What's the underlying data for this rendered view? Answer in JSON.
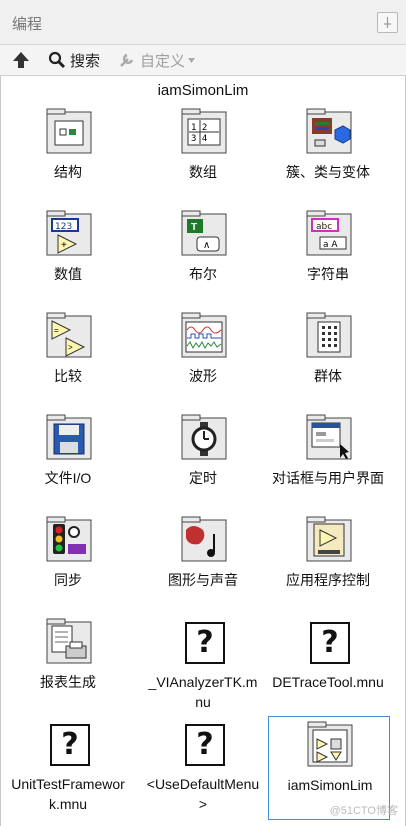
{
  "window": {
    "title": "编程"
  },
  "toolbar": {
    "up_label": "",
    "search_label": "搜索",
    "custom_label": "自定义"
  },
  "palette": {
    "title": "iamSimonLim"
  },
  "items": [
    {
      "label": "结构",
      "icon": "structures-icon"
    },
    {
      "label": "数组",
      "icon": "array-icon"
    },
    {
      "label": "簇、类与变体",
      "icon": "cluster-class-variant-icon"
    },
    {
      "label": "数值",
      "icon": "numeric-icon"
    },
    {
      "label": "布尔",
      "icon": "boolean-icon"
    },
    {
      "label": "字符串",
      "icon": "string-icon"
    },
    {
      "label": "比较",
      "icon": "comparison-icon"
    },
    {
      "label": "波形",
      "icon": "waveform-icon"
    },
    {
      "label": "群体",
      "icon": "collections-icon"
    },
    {
      "label": "文件I/O",
      "icon": "file-io-icon"
    },
    {
      "label": "定时",
      "icon": "timing-icon"
    },
    {
      "label": "对话框与用户界面",
      "icon": "dialog-ui-icon"
    },
    {
      "label": "同步",
      "icon": "synchronization-icon"
    },
    {
      "label": "图形与声音",
      "icon": "graphics-sound-icon"
    },
    {
      "label": "应用程序控制",
      "icon": "app-control-icon"
    },
    {
      "label": "报表生成",
      "icon": "report-generation-icon"
    },
    {
      "label": "_VIAnalyzerTK.mnu",
      "icon": "unknown-icon"
    },
    {
      "label": "DETraceTool.mnu",
      "icon": "unknown-icon"
    },
    {
      "label": "UnitTestFramework.mnu",
      "icon": "unknown-icon"
    },
    {
      "label": "<UseDefaultMenu>",
      "icon": "unknown-icon"
    },
    {
      "label": "iamSimonLim",
      "icon": "iamsimonlim-icon"
    }
  ],
  "watermark": "@51CTO博客"
}
